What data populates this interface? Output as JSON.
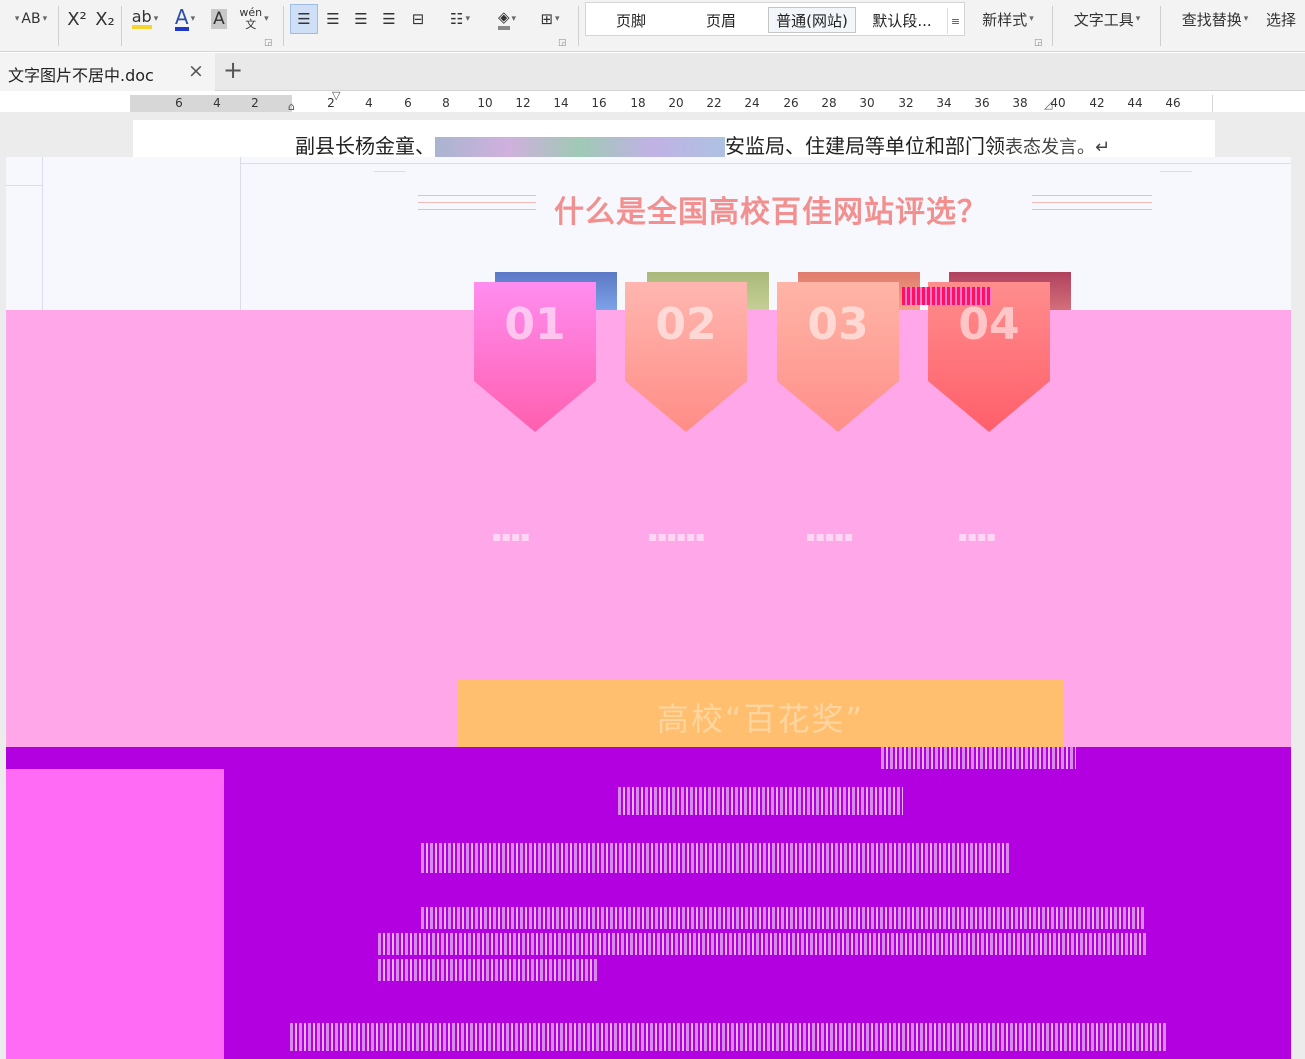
{
  "toolbar": {
    "font_tools": [
      "AB",
      "X²",
      "X₂",
      "ab",
      "A",
      "A",
      "wén"
    ],
    "style_gallery": [
      {
        "label": "页脚",
        "active": false
      },
      {
        "label": "页眉",
        "active": false
      },
      {
        "label": "普通(网站)",
        "active": true
      },
      {
        "label": "默认段...",
        "active": false
      }
    ],
    "new_style": "新样式",
    "text_tools": "文字工具",
    "find_replace": "查找替换",
    "select": "选择"
  },
  "tabs": {
    "active_doc": "文字图片不居中.doc",
    "close_glyph": "×",
    "new_tab_glyph": "+"
  },
  "ruler": {
    "left_numbers": [
      "6",
      "4",
      "2"
    ],
    "right_numbers": [
      "2",
      "4",
      "6",
      "8",
      "10",
      "12",
      "14",
      "16",
      "18",
      "20",
      "22",
      "24",
      "26",
      "28",
      "30",
      "32",
      "34",
      "36",
      "38",
      "40",
      "42",
      "44",
      "46"
    ]
  },
  "document": {
    "line_start": "副县长杨金童、",
    "line_mid": "安监局、住建局等单位和部门领",
    "line_end": "表态发言。↵"
  },
  "web": {
    "title": "什么是全国高校百佳网站评选？",
    "badges": [
      "01",
      "02",
      "03",
      "04"
    ],
    "button_label": "高校“百花奖”"
  },
  "colors": {
    "pink_block": "#ffa7e8",
    "purple_block": "#b300e0",
    "title_color": "#f28f8f",
    "button_color": "#ffbf6e"
  }
}
